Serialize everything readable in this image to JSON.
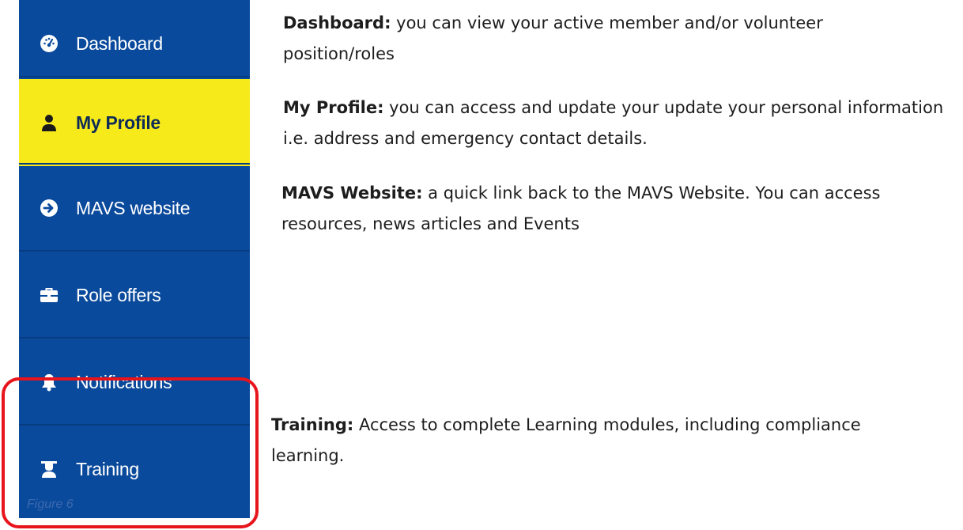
{
  "sidebar": {
    "items": [
      {
        "label": "Dashboard",
        "icon": "dashboard-icon"
      },
      {
        "label": "My Profile",
        "icon": "user-icon",
        "active": true
      },
      {
        "label": "MAVS website",
        "icon": "arrow-circle-right-icon"
      },
      {
        "label": "Role offers",
        "icon": "briefcase-icon"
      },
      {
        "label": "Notifications",
        "icon": "bell-icon"
      },
      {
        "label": "Training",
        "icon": "graduation-icon"
      }
    ],
    "caption": "Figure 6",
    "colors": {
      "background": "#0a4a9c",
      "active_background": "#f7ea1b",
      "highlight_border": "#e8141c"
    }
  },
  "descriptions": [
    {
      "term": "Dashboard:",
      "text": " you can view your active member and/or volunteer position/roles"
    },
    {
      "term": "My Profile:",
      "text": " you can access and update your update your personal information i.e. address and emergency contact details."
    },
    {
      "term": "MAVS Website:",
      "text": " a quick link back to the MAVS Website. You can access resources, news articles and Events"
    },
    {
      "term": "Training:",
      "text": " Access to complete Learning modules, including compliance learning."
    }
  ]
}
